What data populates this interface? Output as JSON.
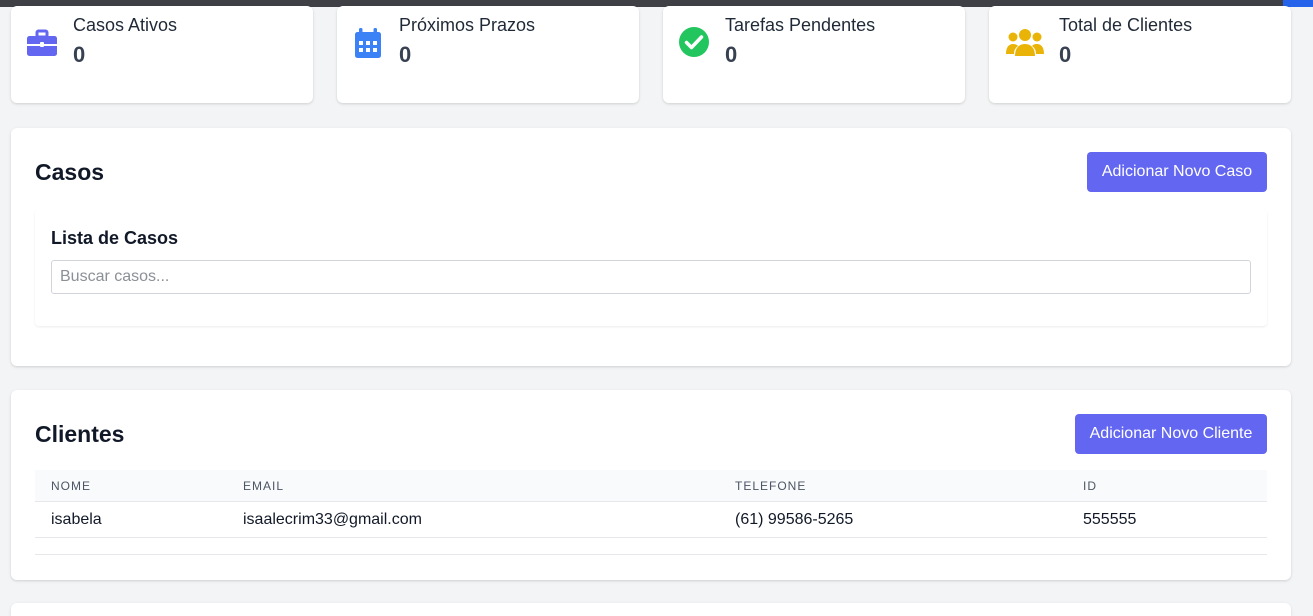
{
  "stats": [
    {
      "label": "Casos Ativos",
      "value": "0",
      "icon": "briefcase-icon",
      "color": "#6366f1"
    },
    {
      "label": "Próximos Prazos",
      "value": "0",
      "icon": "calendar-icon",
      "color": "#3b82f6"
    },
    {
      "label": "Tarefas Pendentes",
      "value": "0",
      "icon": "check-circle-icon",
      "color": "#22c55e"
    },
    {
      "label": "Total de Clientes",
      "value": "0",
      "icon": "users-icon",
      "color": "#eab308"
    }
  ],
  "cases": {
    "title": "Casos",
    "add_button": "Adicionar Novo Caso",
    "list_title": "Lista de Casos",
    "search_placeholder": "Buscar casos..."
  },
  "clients": {
    "title": "Clientes",
    "add_button": "Adicionar Novo Cliente",
    "columns": [
      "Nome",
      "Email",
      "Telefone",
      "ID"
    ],
    "rows": [
      [
        "isabela",
        "isaalecrim33@gmail.com",
        "(61) 99586-5265",
        "555555"
      ]
    ]
  },
  "colors": {
    "accent": "#6366f1",
    "background": "#f3f4f6"
  }
}
